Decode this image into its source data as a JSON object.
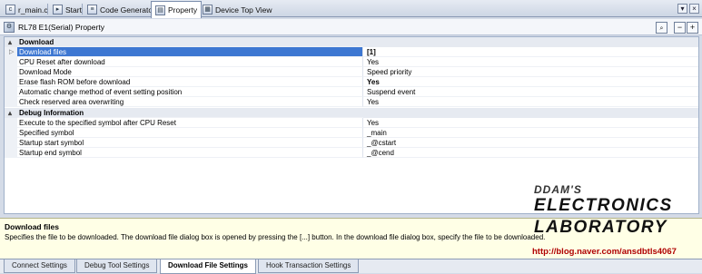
{
  "tabs": [
    {
      "label": "r_main.c",
      "icon": "c-file-icon"
    },
    {
      "label": "Start",
      "icon": "start-icon"
    },
    {
      "label": "Code Generator",
      "icon": "code-generator-icon"
    },
    {
      "label": "Property",
      "icon": "property-icon",
      "active": true
    },
    {
      "label": "Device Top View",
      "icon": "device-view-icon"
    }
  ],
  "window_controls": {
    "dropdown": "▾",
    "close": "×"
  },
  "panel": {
    "title": "RL78 E1(Serial) Property",
    "buttons": {
      "search": "🔍",
      "expand": "−",
      "collapse": "+"
    }
  },
  "categories": [
    {
      "name": "Download",
      "rows": [
        {
          "property": "Download files",
          "value": "[1]",
          "selected": true,
          "expandable": true
        },
        {
          "property": "CPU Reset after download",
          "value": "Yes"
        },
        {
          "property": "Download Mode",
          "value": "Speed priority"
        },
        {
          "property": "Erase flash ROM before download",
          "value": "Yes",
          "bold": true
        },
        {
          "property": "Automatic change method of event setting position",
          "value": "Suspend event"
        },
        {
          "property": "Check reserved area overwriting",
          "value": "Yes"
        }
      ]
    },
    {
      "name": "Debug Information",
      "rows": [
        {
          "property": "Execute to the specified symbol after CPU Reset",
          "value": "Yes"
        },
        {
          "property": "Specified symbol",
          "value": "_main"
        },
        {
          "property": "Startup start symbol",
          "value": "_@cstart"
        },
        {
          "property": "Startup end symbol",
          "value": "_@cend"
        }
      ]
    }
  ],
  "description": {
    "heading": "Download files",
    "text": "Specifies the file to be downloaded. The download file dialog box is opened by pressing the [...] button. In the download file dialog box, specify the file to be downloaded."
  },
  "watermark": {
    "line1": "DDAM'S",
    "line2": "ELECTRONICS",
    "line3": "LABORATORY",
    "url": "http://blog.naver.com/ansdbtls4067"
  },
  "bottom_tabs": [
    {
      "label": "Connect Settings"
    },
    {
      "label": "Debug Tool Settings"
    },
    {
      "label": "Download File Settings",
      "active": true
    },
    {
      "label": "Hook Transaction Settings"
    }
  ]
}
